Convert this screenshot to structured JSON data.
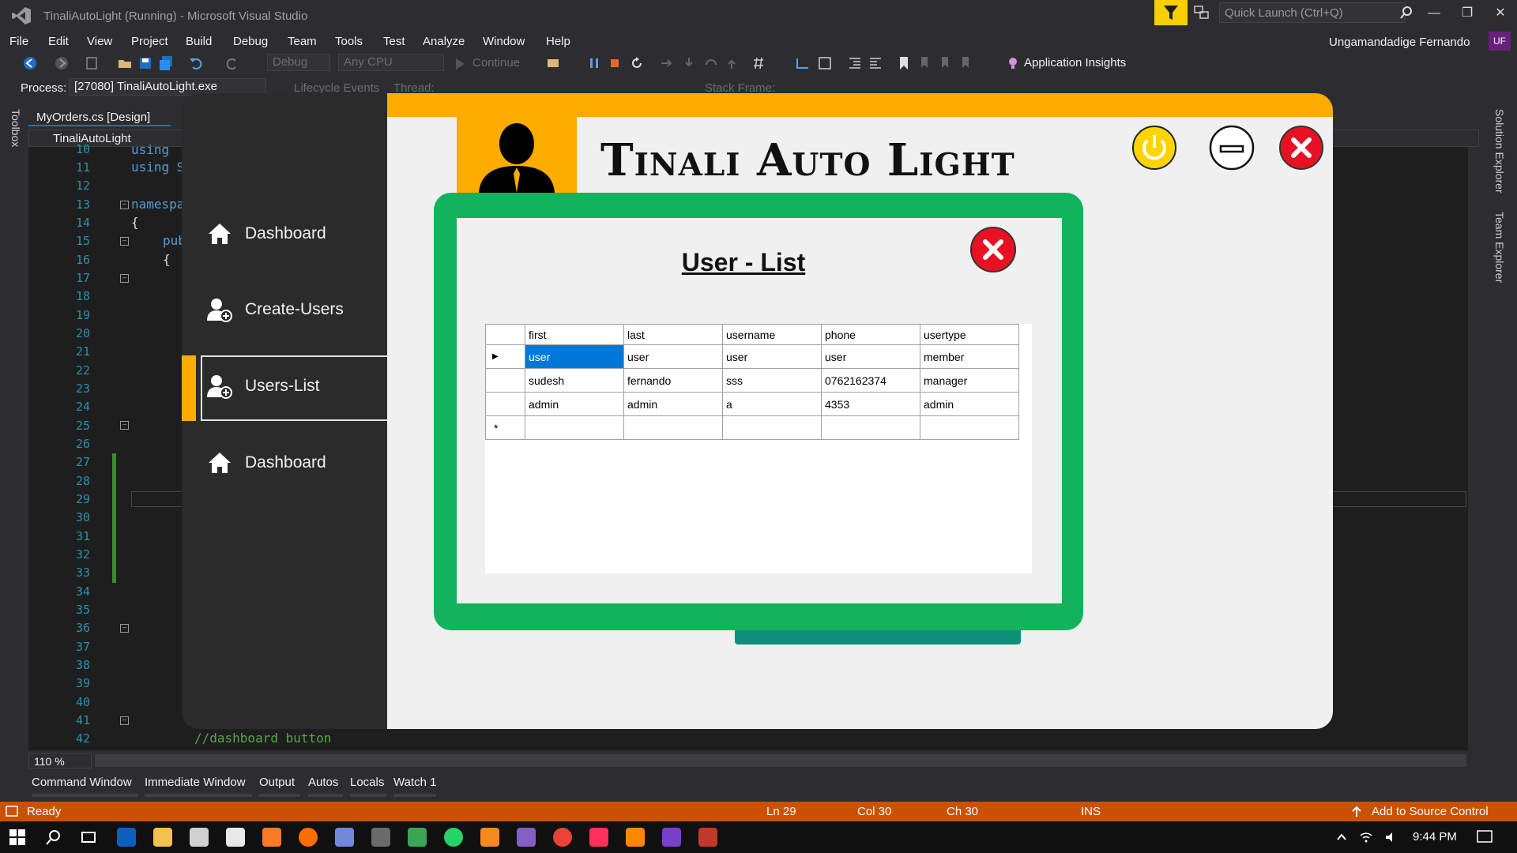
{
  "titlebar": {
    "title": "TinaliAutoLight (Running) - Microsoft Visual Studio",
    "quick_launch_placeholder": "Quick Launch (Ctrl+Q)"
  },
  "menu": [
    "File",
    "Edit",
    "View",
    "Project",
    "Build",
    "Debug",
    "Team",
    "Tools",
    "Test",
    "Analyze",
    "Window",
    "Help"
  ],
  "account": {
    "name": "Ungamandadige Fernando",
    "initials": "UF"
  },
  "toolbar": {
    "config": "Debug",
    "platform": "Any CPU",
    "continue_label": "Continue",
    "app_insights": "Application Insights"
  },
  "debug_bar": {
    "process_label": "Process:",
    "process_value": "[27080] TinaliAutoLight.exe",
    "lifecycle": "Lifecycle Events",
    "thread_label": "Thread:",
    "stack_frame_label": "Stack Frame:"
  },
  "side_tabs": {
    "toolbox": "Toolbox",
    "solution_explorer": "Solution Explorer",
    "team_explorer": "Team Explorer"
  },
  "editor": {
    "tab": "MyOrders.cs [Design]",
    "nav_project": "TinaliAutoLight",
    "line_numbers": [
      "10",
      "11",
      "12",
      "13",
      "14",
      "15",
      "16",
      "17",
      "18",
      "19",
      "20",
      "21",
      "22",
      "23",
      "24",
      "25",
      "26",
      "27",
      "28",
      "29",
      "30",
      "31",
      "32",
      "33",
      "34",
      "35",
      "36",
      "37",
      "38",
      "39",
      "40",
      "41",
      "42"
    ],
    "code_line_10": "using ",
    "code_line_11": "using S",
    "code_line_13": "namespa",
    "code_line_14": "{",
    "code_line_15": "pub",
    "code_line_16": "{",
    "code_line_42": "//dashboard button",
    "zoom": "110 %"
  },
  "bottom_tabs": [
    "Command Window",
    "Immediate Window",
    "Output",
    "Autos",
    "Locals",
    "Watch 1"
  ],
  "status": {
    "state": "Ready",
    "line": "Ln 29",
    "col": "Col 30",
    "ch": "Ch 30",
    "mode": "INS",
    "source_control": "Add to Source Control"
  },
  "taskbar": {
    "time": "9:44 PM"
  },
  "app": {
    "title": "Tinali Auto Light",
    "nav": [
      {
        "label": "Dashboard",
        "icon": "home-icon"
      },
      {
        "label": "Create-Users",
        "icon": "add-user-icon"
      },
      {
        "label": "Users-List",
        "icon": "add-user-icon"
      },
      {
        "label": "Dashboard",
        "icon": "home-icon"
      }
    ],
    "active_nav": "Users-List",
    "colors": {
      "accent": "#ffab00",
      "dialog_border": "#12b35b",
      "close_red": "#e81123",
      "selected_cell": "#0078d7"
    }
  },
  "dialog": {
    "title": "User - List",
    "columns": [
      "first",
      "last",
      "username",
      "phone",
      "usertype"
    ],
    "rows": [
      [
        "user",
        "user",
        "user",
        "user",
        "member"
      ],
      [
        "sudesh",
        "fernando",
        "sss",
        "0762162374",
        "manager"
      ],
      [
        "admin",
        "admin",
        "a",
        "4353",
        "admin"
      ]
    ],
    "current_row_marker": "▶",
    "new_row_marker": "*"
  }
}
